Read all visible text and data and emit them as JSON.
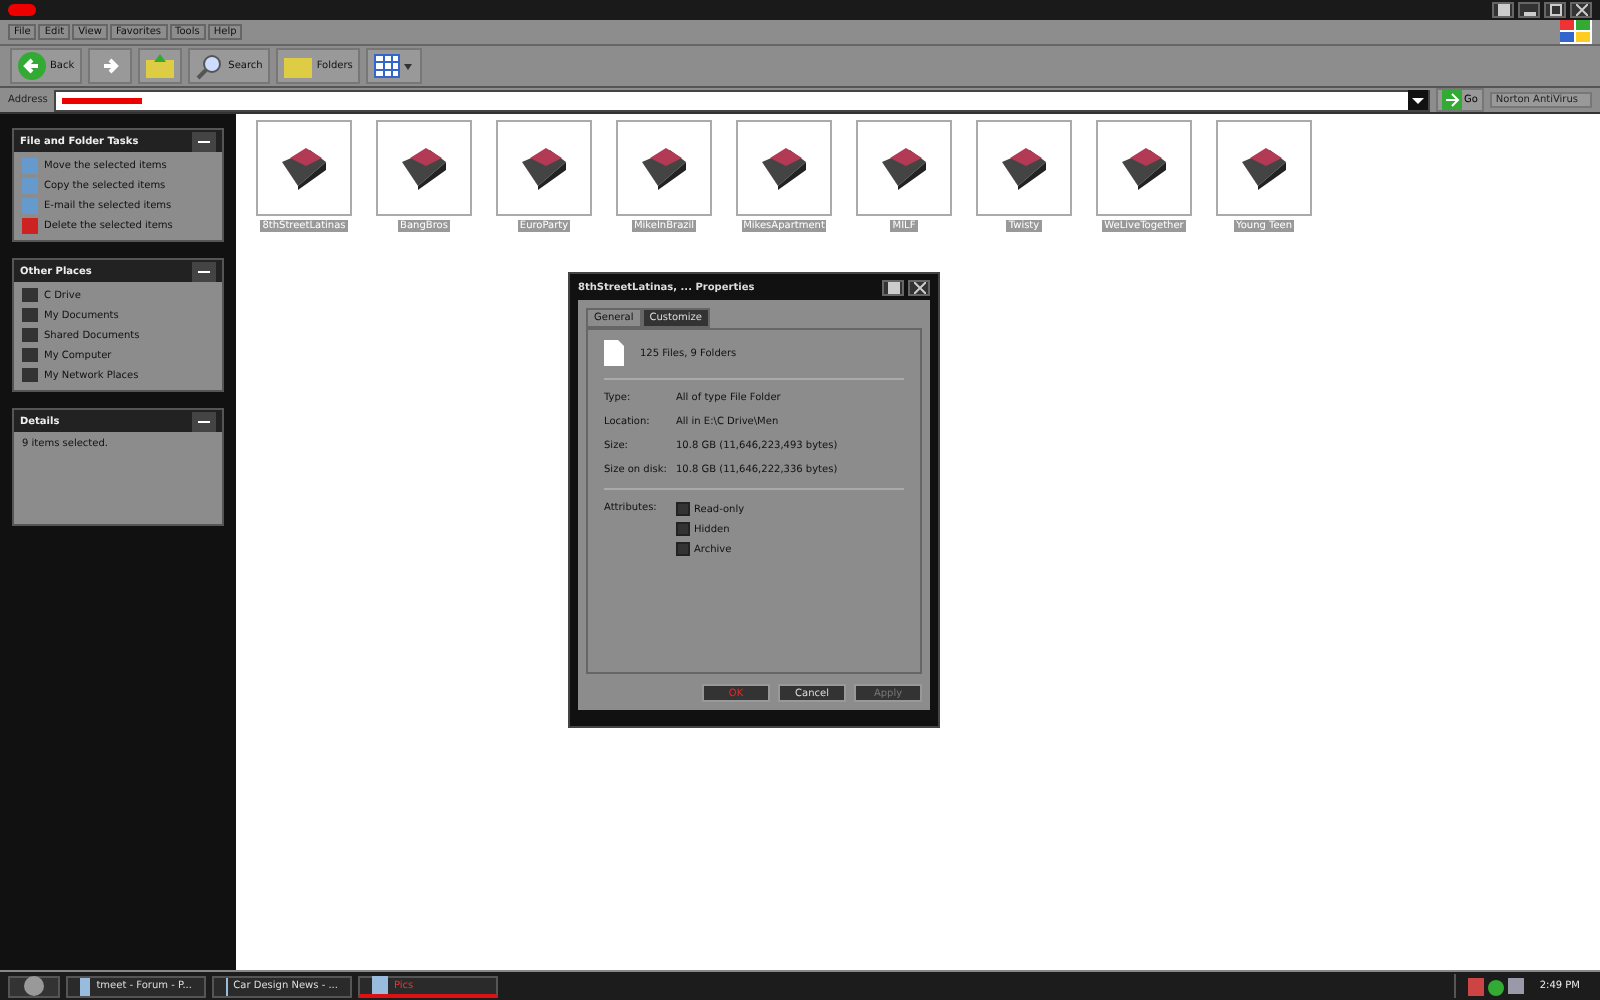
{
  "menu": [
    "File",
    "Edit",
    "View",
    "Favorites",
    "Tools",
    "Help"
  ],
  "toolbar": {
    "back": "Back",
    "search": "Search",
    "folders": "Folders"
  },
  "address": {
    "label": "Address",
    "go": "Go",
    "norton": "Norton AntiVirus"
  },
  "sidebar": [
    {
      "title": "File and Folder Tasks",
      "kind": "tasks",
      "items": [
        "Move the selected items",
        "Copy the selected items",
        "E-mail the selected items",
        "Delete the selected items"
      ]
    },
    {
      "title": "Other Places",
      "kind": "places",
      "items": [
        "C Drive",
        "My Documents",
        "Shared Documents",
        "My Computer",
        "My Network Places"
      ]
    },
    {
      "title": "Details",
      "kind": "details",
      "items": [
        "9 items selected."
      ]
    }
  ],
  "folders": [
    {
      "name": "8thStreetLatinas",
      "selected": true
    },
    {
      "name": "BangBros",
      "selected": true
    },
    {
      "name": "EuroParty",
      "selected": true
    },
    {
      "name": "MikeInBrazil",
      "selected": true
    },
    {
      "name": "MikesApartment",
      "selected": true
    },
    {
      "name": "MILF",
      "selected": true
    },
    {
      "name": "Twisty",
      "selected": true
    },
    {
      "name": "WeLiveTogether",
      "selected": true
    },
    {
      "name": "Young Teen",
      "selected": true
    }
  ],
  "dialog": {
    "title": "8thStreetLatinas, ... Properties",
    "tabs": [
      {
        "label": "General",
        "selected": true
      },
      {
        "label": "Customize",
        "selected": false
      }
    ],
    "summary": "125 Files, 9 Folders",
    "fields": [
      {
        "label": "Type:",
        "value": "All of type File Folder"
      },
      {
        "label": "Location:",
        "value": "All in E:\\C Drive\\Men"
      }
    ],
    "sizes": [
      {
        "label": "Size:",
        "value": "10.8 GB (11,646,223,493 bytes)"
      },
      {
        "label": "Size on disk:",
        "value": "10.8 GB (11,646,222,336 bytes)"
      }
    ],
    "attributes_label": "Attributes:",
    "attributes": [
      {
        "label": "Read-only",
        "checked": false
      },
      {
        "label": "Hidden",
        "checked": false
      },
      {
        "label": "Archive",
        "checked": false
      }
    ],
    "buttons": [
      {
        "label": "OK",
        "disabled": false
      },
      {
        "label": "Cancel",
        "disabled": false
      },
      {
        "label": "Apply",
        "disabled": true
      }
    ]
  },
  "taskbar": {
    "tasks": [
      {
        "label": "tmeet - Forum - P...",
        "selected": false
      },
      {
        "label": "Car Design News - ...",
        "selected": false
      },
      {
        "label": "Pics",
        "selected": true
      }
    ],
    "clock": "2:49 PM"
  }
}
